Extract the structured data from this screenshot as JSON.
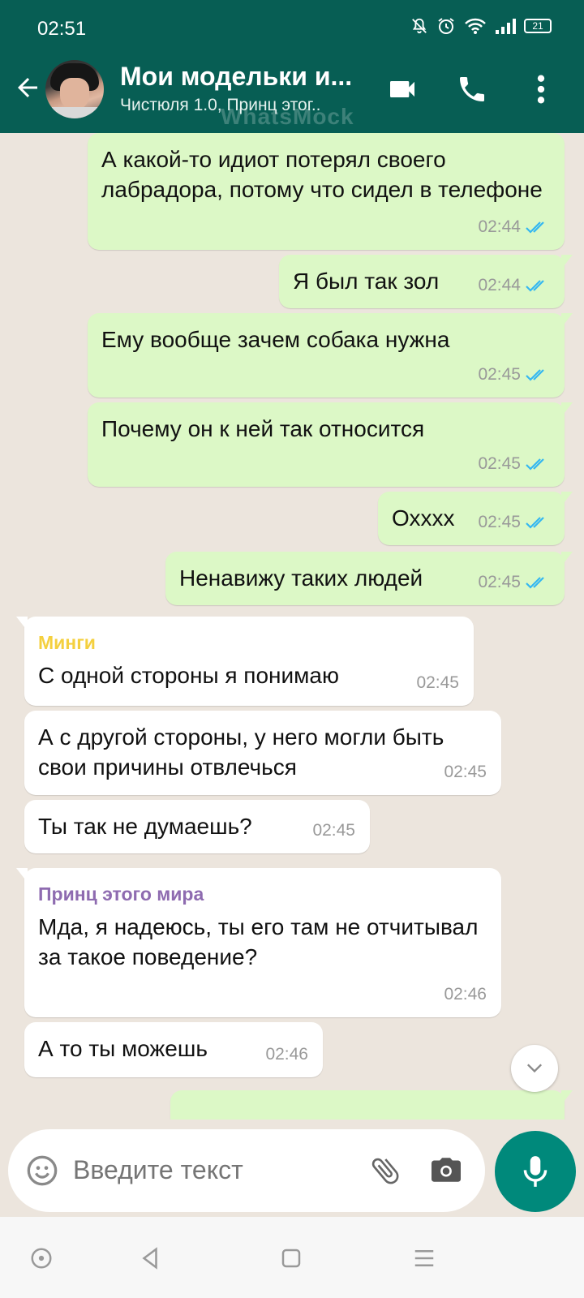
{
  "status_bar": {
    "time": "02:51",
    "battery": "21"
  },
  "header": {
    "title": "Мои модельки и...",
    "subtitle": "Чистюля 1.0, Принц этог..",
    "watermark": "WhatsMock"
  },
  "messages": [
    {
      "direction": "out",
      "text": "А какой-то идиот потерял своего лабрадора, потому что сидел в телефоне",
      "time": "02:44"
    },
    {
      "direction": "out",
      "text": "Я был так зол",
      "time": "02:44"
    },
    {
      "direction": "out",
      "text": "Ему вообще зачем собака нужна",
      "time": "02:45"
    },
    {
      "direction": "out",
      "text": "Почему он к ней так относится",
      "time": "02:45"
    },
    {
      "direction": "out",
      "text": "Охххх",
      "time": "02:45"
    },
    {
      "direction": "out",
      "text": "Ненавижу таких людей",
      "time": "02:45"
    },
    {
      "direction": "in",
      "sender": "Минги",
      "sender_color": "#f4d03f",
      "text": "С одной стороны я понимаю",
      "time": "02:45"
    },
    {
      "direction": "in",
      "text": "А с другой стороны, у него могли быть свои причины отвлечься",
      "time": "02:45"
    },
    {
      "direction": "in",
      "text": "Ты так не думаешь?",
      "time": "02:45"
    },
    {
      "direction": "in",
      "sender": "Принц этого мира",
      "sender_color": "#8e6bb0",
      "text": "Мда, я надеюсь, ты его там не отчитывал за такое поведение?",
      "time": "02:46"
    },
    {
      "direction": "in",
      "text": "А то ты можешь",
      "time": "02:46"
    }
  ],
  "input": {
    "placeholder": "Введите текст"
  },
  "colors": {
    "header": "#075e54",
    "outgoing": "#dcf8c6",
    "incoming": "#ffffff",
    "mic": "#00897b",
    "read_ticks": "#34b7f1"
  },
  "icons": [
    "back-arrow-icon",
    "video-call-icon",
    "phone-icon",
    "more-vert-icon",
    "emoji-icon",
    "attach-icon",
    "camera-icon",
    "mic-icon",
    "chevron-down-icon"
  ]
}
